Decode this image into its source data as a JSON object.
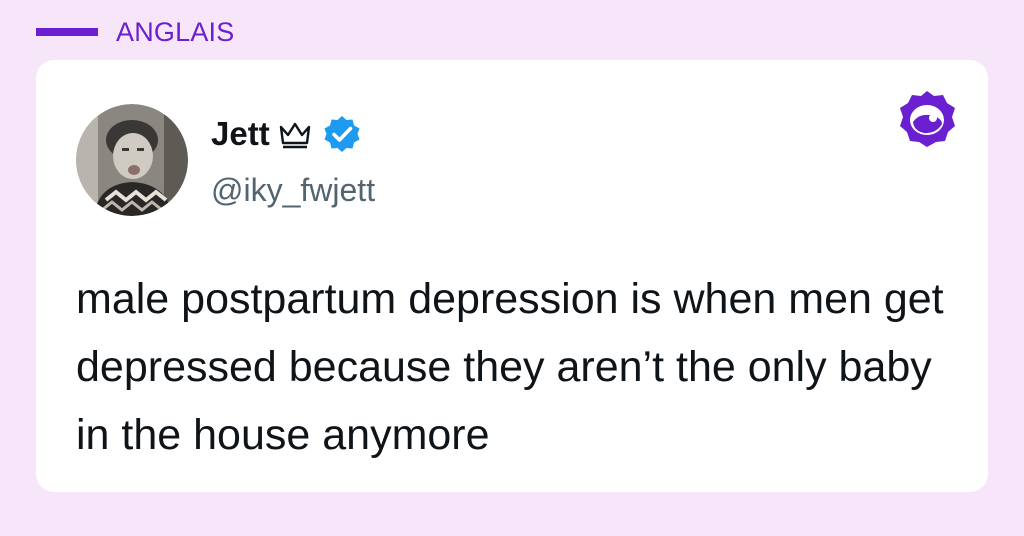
{
  "category_label": "ANGLAIS",
  "tweet": {
    "display_name": "Jett",
    "handle": "@iky_fwjett",
    "text": "male postpartum depression is when men get depressed because they aren’t the only baby in the house anymore",
    "verified": true
  },
  "icons": {
    "name_badge": "crown-icon",
    "verification": "verified-icon",
    "brand": "brand-logo"
  },
  "colors": {
    "background": "#f7e6f9",
    "accent": "#6a1fd0",
    "verified": "#1d9bf0",
    "text_primary": "#0f1419",
    "text_secondary": "#536471"
  }
}
